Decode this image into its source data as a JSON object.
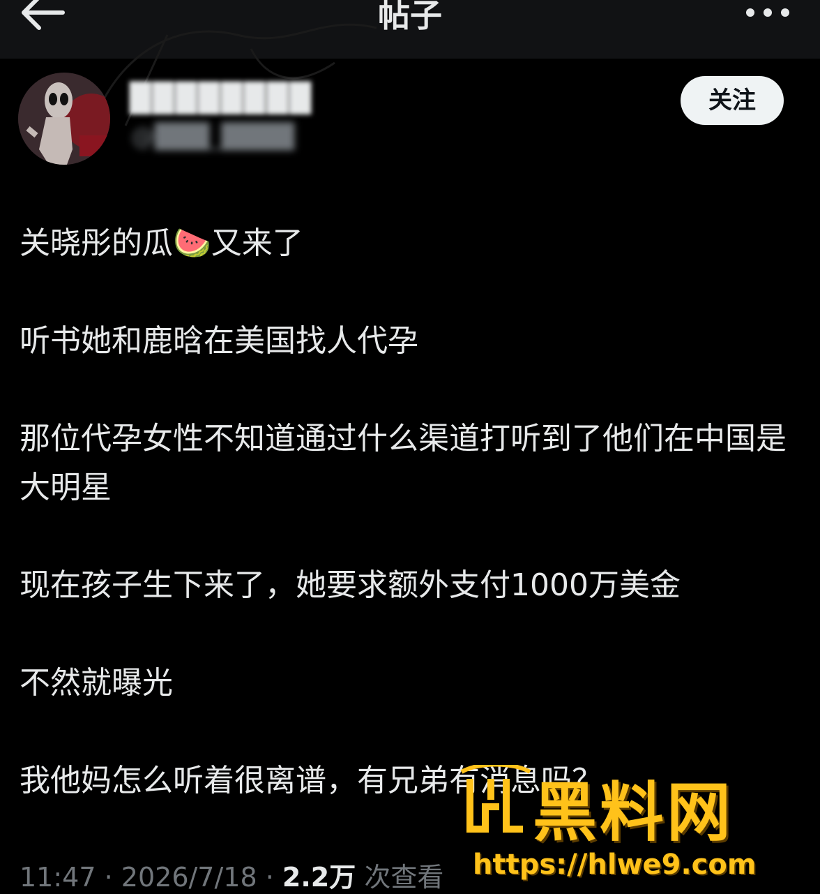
{
  "header": {
    "title": "帖子"
  },
  "author": {
    "follow_label": "关注"
  },
  "post": {
    "paragraphs": [
      "关晓彤的瓜🍉又来了",
      "听书她和鹿晗在美国找人代孕",
      "那位代孕女性不知道通过什么渠道打听到了他们在中国是大明星",
      "现在孩子生下来了，她要求额外支付1000万美金",
      "不然就曝光",
      "我他妈怎么听着很离谱，有兄弟有消息吗？"
    ],
    "time": "11:47",
    "date": "2026/7/18",
    "separator": "·",
    "views": "2.2万",
    "views_label": "次查看"
  },
  "watermark": {
    "title": "黑料网",
    "url": "https://hlwe9.com"
  },
  "colors": {
    "background": "#000000",
    "text": "#e7e9ea",
    "muted": "#71767b",
    "follow_bg": "#eff3f4",
    "watermark": "#ffc21a"
  },
  "icons": [
    "back-arrow-icon",
    "more-options-icon",
    "avatar",
    "watermark-logo"
  ]
}
